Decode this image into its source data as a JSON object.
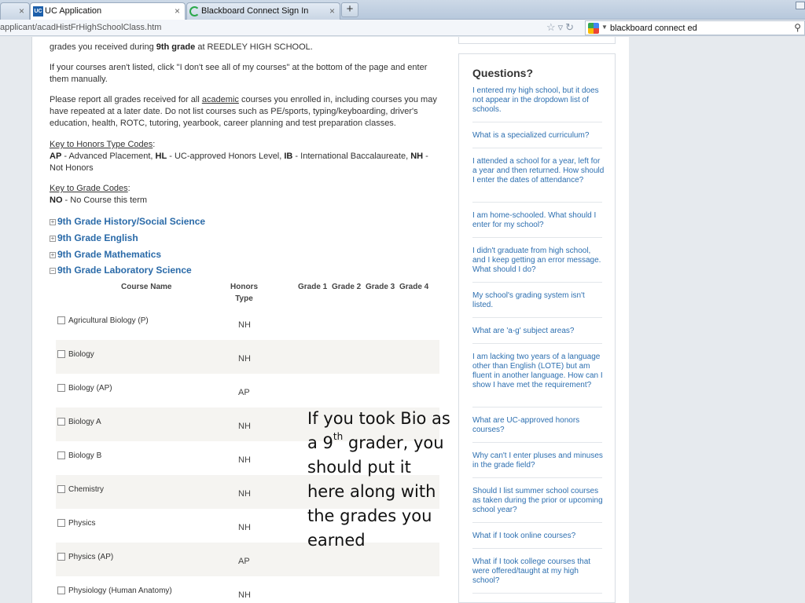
{
  "browser": {
    "tabs": [
      {
        "label": "UC Application",
        "favicon": "uc-icon"
      },
      {
        "label": "Blackboard Connect Sign In",
        "favicon": "blackboard-c-icon"
      }
    ],
    "close_glyph": "×",
    "new_tab_glyph": "+",
    "url": "applicant/acadHistFrHighSchoolClass.htm",
    "search_value": "blackboard connect ed"
  },
  "intro": {
    "line1_a": "grades you received during ",
    "line1_b": "9th grade",
    "line1_c": " at REEDLEY HIGH SCHOOL.",
    "p2": "If your courses aren't listed, click \"I don't see all of my courses\" at the bottom of the page and enter them manually.",
    "p3_a": "Please report all grades received for all ",
    "p3_u": "academic",
    "p3_b": " courses you enrolled in, including courses you may have repeated at a later date. Do not list courses such as PE/sports, typing/keyboarding, driver's education, health, ROTC, tutoring, yearbook, career planning and test preparation classes."
  },
  "honors_key": {
    "title": "Key to Honors Type Codes",
    "colon": ":",
    "ap": "AP",
    "ap_desc": " - Advanced Placement, ",
    "hl": "HL",
    "hl_desc": " - UC-approved Honors Level, ",
    "ib": "IB",
    "ib_desc": " - International Baccalaureate, ",
    "nh": "NH",
    "nh_desc": " - Not Honors"
  },
  "grade_key": {
    "title": "Key to Grade Codes",
    "colon": ":",
    "no": "NO",
    "no_desc": " - No Course this term"
  },
  "sections": [
    {
      "label": "9th Grade History/Social Science",
      "expanded": false,
      "glyph": "+"
    },
    {
      "label": "9th Grade English",
      "expanded": false,
      "glyph": "+"
    },
    {
      "label": "9th Grade Mathematics",
      "expanded": false,
      "glyph": "+"
    },
    {
      "label": "9th Grade Laboratory Science",
      "expanded": true,
      "glyph": "−"
    }
  ],
  "table": {
    "headers": {
      "course": "Course Name",
      "honors_1": "Honors",
      "honors_2": "Type",
      "grade1": "Grade 1",
      "grade2": "Grade 2",
      "grade3": "Grade 3",
      "grade4": "Grade 4"
    },
    "rows": [
      {
        "course": "Agricultural Biology (P)",
        "honors": "NH"
      },
      {
        "course": "Biology",
        "honors": "NH"
      },
      {
        "course": "Biology (AP)",
        "honors": "AP"
      },
      {
        "course": "Biology A",
        "honors": "NH"
      },
      {
        "course": "Biology B",
        "honors": "NH"
      },
      {
        "course": "Chemistry",
        "honors": "NH"
      },
      {
        "course": "Physics",
        "honors": "NH"
      },
      {
        "course": "Physics (AP)",
        "honors": "AP"
      },
      {
        "course": "Physiology (Human Anatomy)",
        "honors": "NH"
      }
    ]
  },
  "annotation": {
    "l1": "If you took Bio as",
    "l2a": "a 9",
    "l2sup": "th",
    "l2b": " grader, you",
    "l3": "should put it",
    "l4": "here along with",
    "l5": "the grades you",
    "l6": "earned"
  },
  "questions": {
    "title": "Questions?",
    "items": [
      "I entered my high school, but it does not appear in the dropdown list of schools.",
      "What is a specialized curriculum?",
      "I attended a school for a year, left for a year and then returned. How should I enter the dates of attendance?",
      "I am home-schooled. What should I enter for my school?",
      "I didn't graduate from high school, and I keep getting an error message. What should I do?",
      "My school's grading system isn't listed.",
      "What are 'a-g' subject areas?",
      "I am lacking two years of a language other than English (LOTE) but am fluent in another language. How can I show I have met the requirement?",
      "What are UC-approved honors courses?",
      "Why can't I enter pluses and minuses in the grade field?",
      "Should I list summer school courses as taken during the prior or upcoming school year?",
      "What if I took online courses?",
      "What if I took college courses that were offered/taught at my high school?"
    ]
  },
  "colors": {
    "link": "#2a6aa8",
    "question_link": "#2d6fb0",
    "row_alt": "#f5f4f1"
  }
}
